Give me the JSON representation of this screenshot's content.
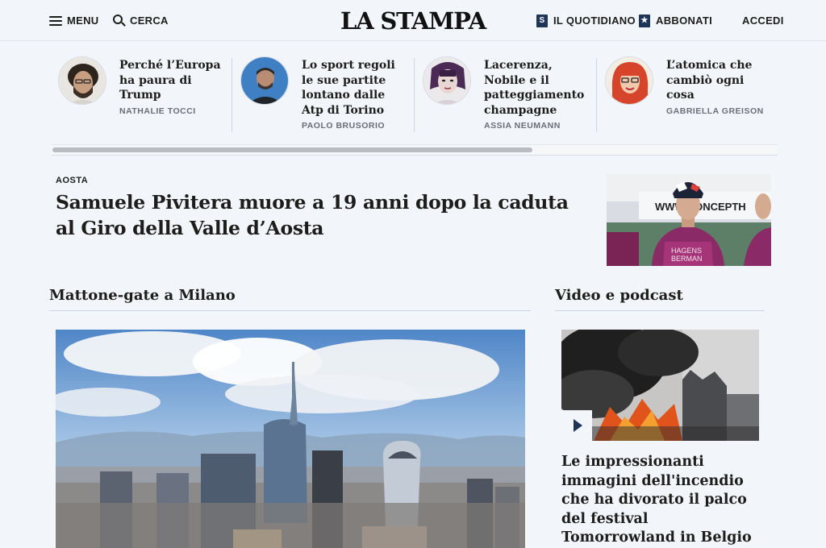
{
  "header": {
    "menu_label": "MENU",
    "search_label": "CERCA",
    "logo": "LA STAMPA",
    "quotidiano_label": "IL QUOTIDIANO",
    "quotidiano_icon_letter": "S",
    "abbonati_label": "ABBONATI",
    "login_label": "ACCEDI"
  },
  "opinions": [
    {
      "title": "Perché l’Europa ha paura di Trump",
      "author": "NATHALIE TOCCI"
    },
    {
      "title": "Lo sport regoli le sue partite lontano dalle Atp di Torino",
      "author": "PAOLO BRUSORIO"
    },
    {
      "title": "Lacerenza, Nobile e il patteggiamento champagne",
      "author": "ASSIA NEUMANN"
    },
    {
      "title": "L’atomica che cambiò ogni cosa",
      "author": "GABRIELLA GREISON"
    }
  ],
  "top_story": {
    "kicker": "AOSTA",
    "title": "Samuele Pivitera muore a 19 anni dopo la caduta al Giro della Valle d’Aosta"
  },
  "sections": {
    "milano_title": "Mattone-gate a Milano",
    "video_title": "Video e podcast"
  },
  "video_story": {
    "title": "Le impressionanti immagini dell'incendio che ha divorato il palco del festival Tomorrowland in Belgio"
  },
  "colors": {
    "background": "#f2f5fa",
    "accent_navy": "#1e3558",
    "text": "#1d1d1b",
    "author_grey": "#6b6f75"
  }
}
